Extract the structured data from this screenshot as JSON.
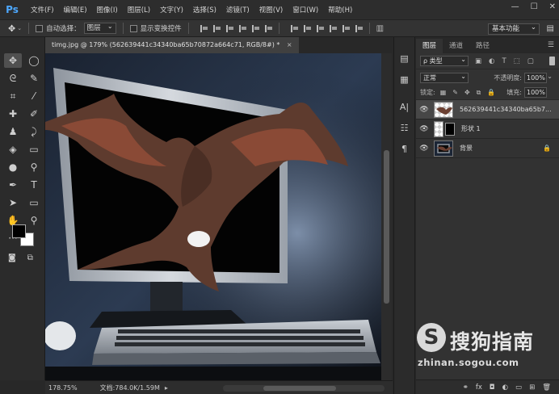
{
  "app": {
    "logo": "Ps"
  },
  "menu": [
    "文件(F)",
    "编辑(E)",
    "图像(I)",
    "图层(L)",
    "文字(Y)",
    "选择(S)",
    "滤镜(T)",
    "视图(V)",
    "窗口(W)",
    "帮助(H)"
  ],
  "window_controls": {
    "minimize": "—",
    "maximize": "☐",
    "close": "✕"
  },
  "options": {
    "tool_icon": "move-icon",
    "auto_select_label": "自动选择：",
    "auto_select_target": "图层",
    "transform_label": "显示变换控件",
    "workspace": "基本功能"
  },
  "document": {
    "tab_title": "timg.jpg @ 179% (562639441c34340ba65b70872a664c71, RGB/8#) *",
    "close": "×"
  },
  "status": {
    "zoom": "178.75%",
    "doc_size": "文档:784.0K/1.59M",
    "arrow": "▸"
  },
  "panel": {
    "tabs": [
      "图层",
      "通道",
      "路径"
    ],
    "active_tab": 0,
    "filter_kind": "ρ 类型",
    "blend_mode": "正常",
    "opacity_label": "不透明度:",
    "opacity_value": "100%",
    "lock_label": "锁定:",
    "fill_label": "填充:",
    "fill_value": "100%",
    "layers": [
      {
        "name": "562639441c34340ba65b7...",
        "selected": true,
        "kind": "image"
      },
      {
        "name": "形状 1",
        "selected": false,
        "kind": "shape"
      },
      {
        "name": "背景",
        "selected": false,
        "kind": "background",
        "locked": true
      }
    ],
    "footer_icons": [
      "⚭",
      "fx",
      "◘",
      "◐",
      "▭",
      "⊞",
      "🗑"
    ]
  },
  "watermark": {
    "text": "搜狗指南",
    "url": "zhinan.sogou.com"
  }
}
